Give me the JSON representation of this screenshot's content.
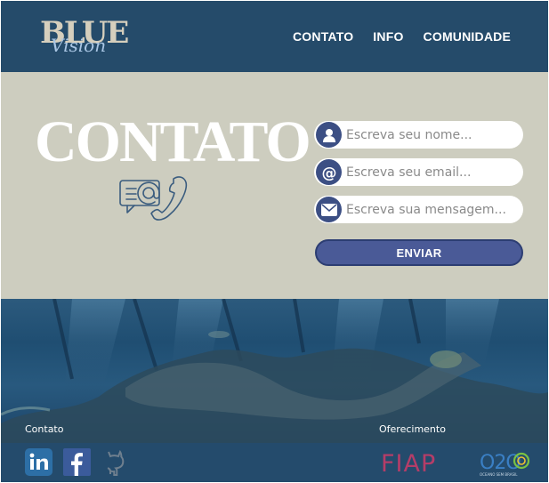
{
  "logo": {
    "line1": "BLUE",
    "line2": "Vision"
  },
  "nav": [
    "CONTATO",
    "INFO",
    "COMUNIDADE"
  ],
  "contact": {
    "title": "CONTATO",
    "name_placeholder": "Escreva seu nome...",
    "email_placeholder": "Escreva seu email...",
    "message_placeholder": "Escreva sua mensagem...",
    "send_label": "ENVIAR"
  },
  "footer": {
    "contato_label": "Contato",
    "oferecimento_label": "Oferecimento",
    "social": [
      "linkedin-icon",
      "facebook-icon",
      "github-icon"
    ],
    "sponsors": {
      "fiap": "FIAP",
      "o2o": "O2O",
      "o2o_sub": "OCEANO SEM BRASIL"
    }
  },
  "colors": {
    "header": "#254b6a",
    "contact_bg": "#cdcdbf",
    "button": "#4a5a97",
    "fiap": "#b43d68"
  }
}
